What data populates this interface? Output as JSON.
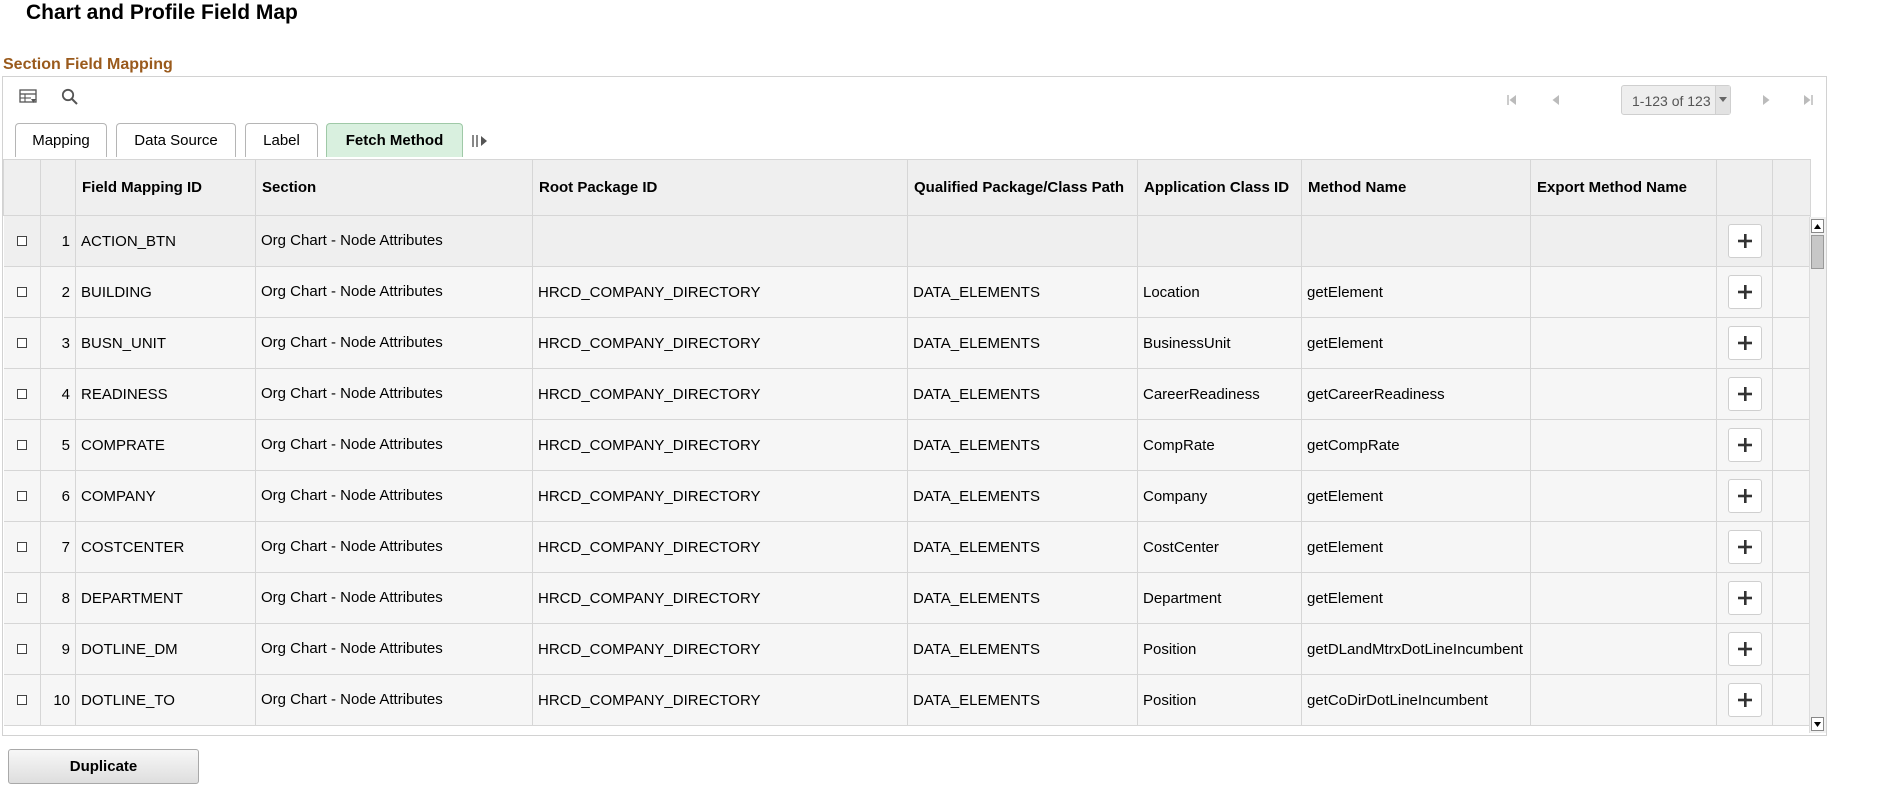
{
  "page": {
    "title": "Chart and Profile Field Map"
  },
  "section": {
    "title": "Section Field Mapping"
  },
  "toolbar": {
    "icons": [
      "personalize-grid-icon",
      "find-icon"
    ],
    "pagination": "1-123 of 123"
  },
  "tabs": [
    {
      "label": "Mapping",
      "active": false
    },
    {
      "label": "Data Source",
      "active": false
    },
    {
      "label": "Label",
      "active": false
    },
    {
      "label": "Fetch Method",
      "active": true
    }
  ],
  "columns": [
    "Field Mapping ID",
    "Section",
    "Root Package ID",
    "Qualified Package/Class Path",
    "Application Class ID",
    "Method Name",
    "Export Method Name"
  ],
  "rows": [
    {
      "num": "1",
      "field_id": "ACTION_BTN",
      "section": "Org Chart - Node Attributes",
      "root_pkg": "",
      "class_path": "",
      "app_class": "",
      "method": "",
      "export_method": ""
    },
    {
      "num": "2",
      "field_id": "BUILDING",
      "section": "Org Chart - Node Attributes",
      "root_pkg": "HRCD_COMPANY_DIRECTORY",
      "class_path": "DATA_ELEMENTS",
      "app_class": "Location",
      "method": "getElement",
      "export_method": ""
    },
    {
      "num": "3",
      "field_id": "BUSN_UNIT",
      "section": "Org Chart - Node Attributes",
      "root_pkg": "HRCD_COMPANY_DIRECTORY",
      "class_path": "DATA_ELEMENTS",
      "app_class": "BusinessUnit",
      "method": "getElement",
      "export_method": ""
    },
    {
      "num": "4",
      "field_id": "READINESS",
      "section": "Org Chart - Node Attributes",
      "root_pkg": "HRCD_COMPANY_DIRECTORY",
      "class_path": "DATA_ELEMENTS",
      "app_class": "CareerReadiness",
      "method": "getCareerReadiness",
      "export_method": ""
    },
    {
      "num": "5",
      "field_id": "COMPRATE",
      "section": "Org Chart - Node Attributes",
      "root_pkg": "HRCD_COMPANY_DIRECTORY",
      "class_path": "DATA_ELEMENTS",
      "app_class": "CompRate",
      "method": "getCompRate",
      "export_method": ""
    },
    {
      "num": "6",
      "field_id": "COMPANY",
      "section": "Org Chart - Node Attributes",
      "root_pkg": "HRCD_COMPANY_DIRECTORY",
      "class_path": "DATA_ELEMENTS",
      "app_class": "Company",
      "method": "getElement",
      "export_method": ""
    },
    {
      "num": "7",
      "field_id": "COSTCENTER",
      "section": "Org Chart - Node Attributes",
      "root_pkg": "HRCD_COMPANY_DIRECTORY",
      "class_path": "DATA_ELEMENTS",
      "app_class": "CostCenter",
      "method": "getElement",
      "export_method": ""
    },
    {
      "num": "8",
      "field_id": "DEPARTMENT",
      "section": "Org Chart - Node Attributes",
      "root_pkg": "HRCD_COMPANY_DIRECTORY",
      "class_path": "DATA_ELEMENTS",
      "app_class": "Department",
      "method": "getElement",
      "export_method": ""
    },
    {
      "num": "9",
      "field_id": "DOTLINE_DM",
      "section": "Org Chart - Node Attributes",
      "root_pkg": "HRCD_COMPANY_DIRECTORY",
      "class_path": "DATA_ELEMENTS",
      "app_class": "Position",
      "method": "getDLandMtrxDotLineIncumbent",
      "export_method": ""
    },
    {
      "num": "10",
      "field_id": "DOTLINE_TO",
      "section": "Org Chart - Node Attributes",
      "root_pkg": "HRCD_COMPANY_DIRECTORY",
      "class_path": "DATA_ELEMENTS",
      "app_class": "Position",
      "method": "getCoDirDotLineIncumbent",
      "export_method": ""
    }
  ],
  "footer": {
    "duplicate_label": "Duplicate"
  },
  "colors": {
    "section_title": "#9a5a1c",
    "active_tab": "#d9f0df"
  }
}
